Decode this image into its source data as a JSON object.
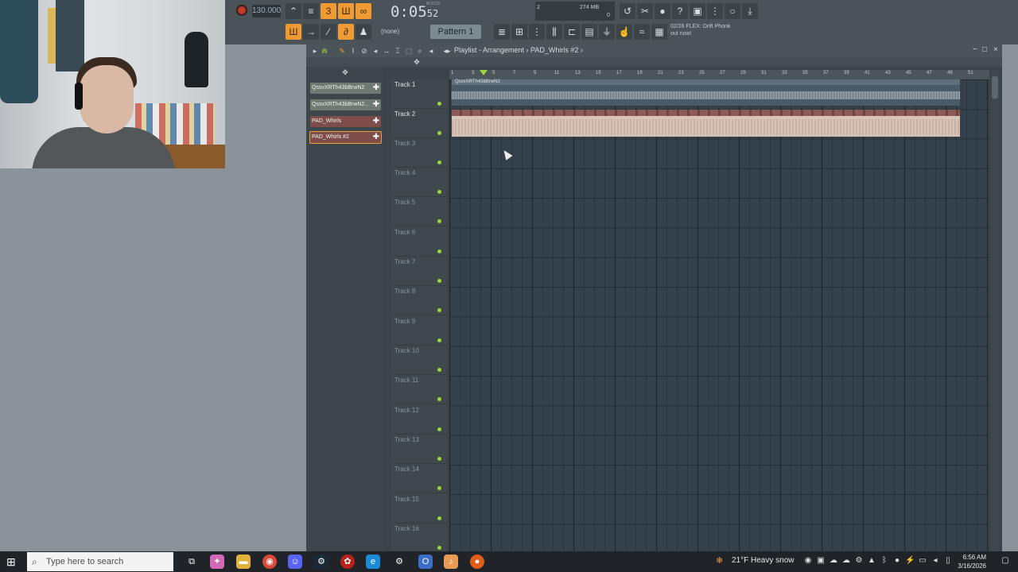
{
  "toolbar": {
    "tempo": "130.000",
    "time": "0:05",
    "time_frac": "52",
    "time_unit": "M:S:CS",
    "meter_value": "274 MB",
    "meter_num": "2",
    "meter_zero": "0",
    "pattern": "Pattern 1",
    "none_label": "(none)",
    "hint_line1": "02/26  FLEX: Drift Phonk",
    "hint_line2": "out now!"
  },
  "playlist": {
    "breadcrumb": "Playlist - Arrangement › PAD_Whirls #2 ›",
    "picker_items": [
      {
        "label": "QssvXRTh43bBrwN2",
        "type": "audio"
      },
      {
        "label": "QssvXRTh43bBrwN2..",
        "type": "audio"
      },
      {
        "label": "PAD_Whirls",
        "type": "pattern"
      },
      {
        "label": "PAD_Whirls #2",
        "type": "pattern"
      }
    ],
    "tracks": [
      "Track 1",
      "Track 2",
      "Track 3",
      "Track 4",
      "Track 5",
      "Track 6",
      "Track 7",
      "Track 8",
      "Track 9",
      "Track 10",
      "Track 11",
      "Track 12",
      "Track 13",
      "Track 14",
      "Track 15",
      "Track 16"
    ],
    "ruler": [
      "1",
      "3",
      "5",
      "7",
      "9",
      "11",
      "13",
      "15",
      "17",
      "19",
      "21",
      "23",
      "25",
      "27",
      "29",
      "31",
      "33",
      "35",
      "37",
      "39",
      "41",
      "43",
      "45",
      "47",
      "49",
      "51"
    ],
    "clip1_label": "QssvXRTh43bBrwN2"
  },
  "taskbar": {
    "search_placeholder": "Type here to search",
    "weather": "21°F  Heavy snow",
    "time": "6:56 AM",
    "date": "3/16/2026"
  },
  "colors": {
    "accent_orange": "#f09a33",
    "track_dot": "#9fd33e",
    "pattern_clip": "#d8c4b6"
  }
}
